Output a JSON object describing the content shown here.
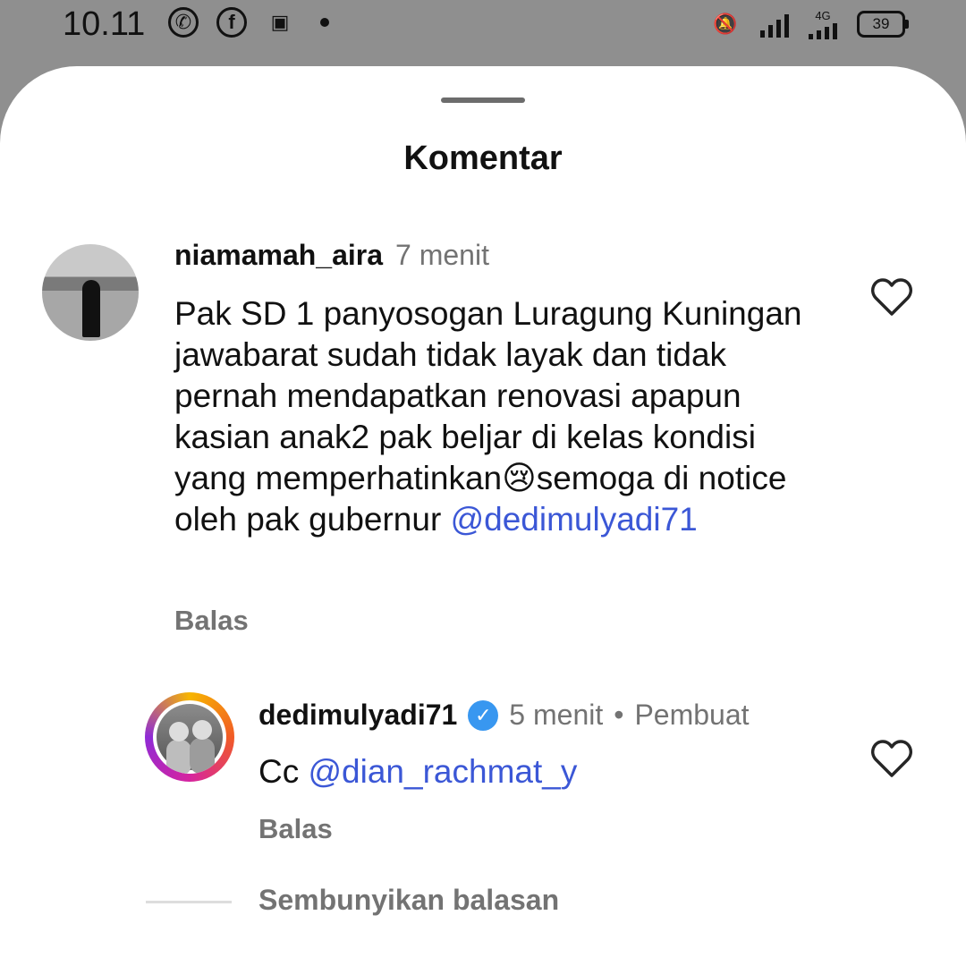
{
  "status_bar": {
    "time": "10.11",
    "left_icons": [
      "whatsapp-icon",
      "facebook-icon",
      "video-icon",
      "dot-icon"
    ],
    "right_icons": [
      "mute-bell-icon",
      "signal-icon",
      "signal-4g-icon",
      "battery-icon"
    ],
    "network_label": "4G",
    "battery_level": "39"
  },
  "sheet": {
    "title": "Komentar"
  },
  "comments": [
    {
      "username": "niamamah_aira",
      "time": "7 menit",
      "text_parts": [
        "Pak SD 1 panyosogan Luragung Kuningan jawabarat sudah tidak layak dan tidak pernah mendapatkan renovasi apapun kasian anak2 pak beljar di kelas kondisi yang memperhatinkan",
        "😢",
        "semoga di notice oleh pak gubernur ",
        "@dedimulyadi71"
      ],
      "reply_label": "Balas"
    }
  ],
  "replies": [
    {
      "username": "dedimulyadi71",
      "verified": true,
      "time": "5 menit",
      "separator": "•",
      "role": "Pembuat",
      "text_prefix": "Cc ",
      "mention": "@dian_rachmat_y",
      "reply_label": "Balas"
    }
  ],
  "hide_replies_label": "Sembunyikan balasan",
  "colors": {
    "mention": "#3b57d6",
    "meta_gray": "#737373",
    "verified": "#3897f0"
  }
}
